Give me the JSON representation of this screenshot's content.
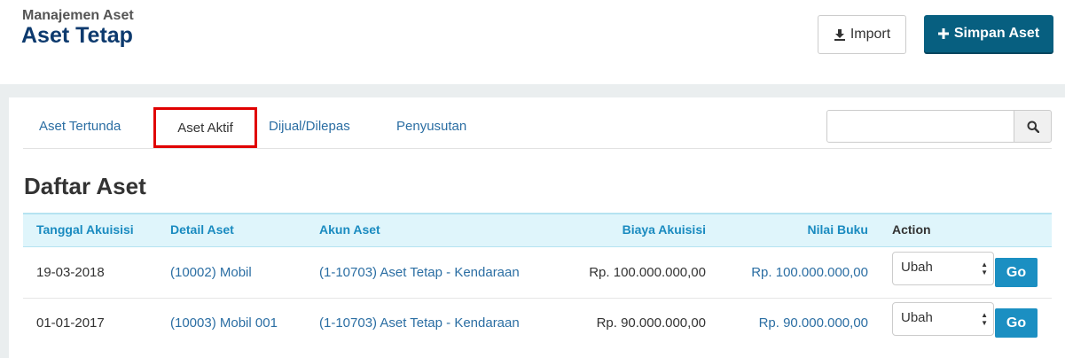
{
  "header": {
    "subtitle": "Manajemen Aset",
    "title": "Aset Tetap",
    "import_label": "Import",
    "save_label": "Simpan Aset"
  },
  "tabs": [
    {
      "label": "Aset Tertunda",
      "active": false
    },
    {
      "label": "Aset Aktif",
      "active": true
    },
    {
      "label": "Dijual/Dilepas",
      "active": false
    },
    {
      "label": "Penyusutan",
      "active": false
    }
  ],
  "search": {
    "value": "",
    "icon": "search-icon"
  },
  "list_title": "Daftar Aset",
  "table": {
    "headers": [
      "Tanggal Akuisisi",
      "Detail Aset",
      "Akun Aset",
      "Biaya Akuisisi",
      "Nilai Buku",
      "Action"
    ],
    "rows": [
      {
        "date": "19-03-2018",
        "detail": "(10002) Mobil",
        "account": "(1-10703) Aset Tetap - Kendaraan",
        "cost": "Rp. 100.000.000,00",
        "book_value": "Rp. 100.000.000,00",
        "action": "Ubah",
        "go": "Go"
      },
      {
        "date": "01-01-2017",
        "detail": "(10003) Mobil 001",
        "account": "(1-10703) Aset Tetap - Kendaraan",
        "cost": "Rp. 90.000.000,00",
        "book_value": "Rp. 90.000.000,00",
        "action": "Ubah",
        "go": "Go"
      }
    ]
  },
  "colors": {
    "brand": "#0d3a6e",
    "primary_button": "#075f80",
    "link": "#2b6ea3",
    "header_row": "#dff5fb",
    "highlight": "#e00000"
  }
}
